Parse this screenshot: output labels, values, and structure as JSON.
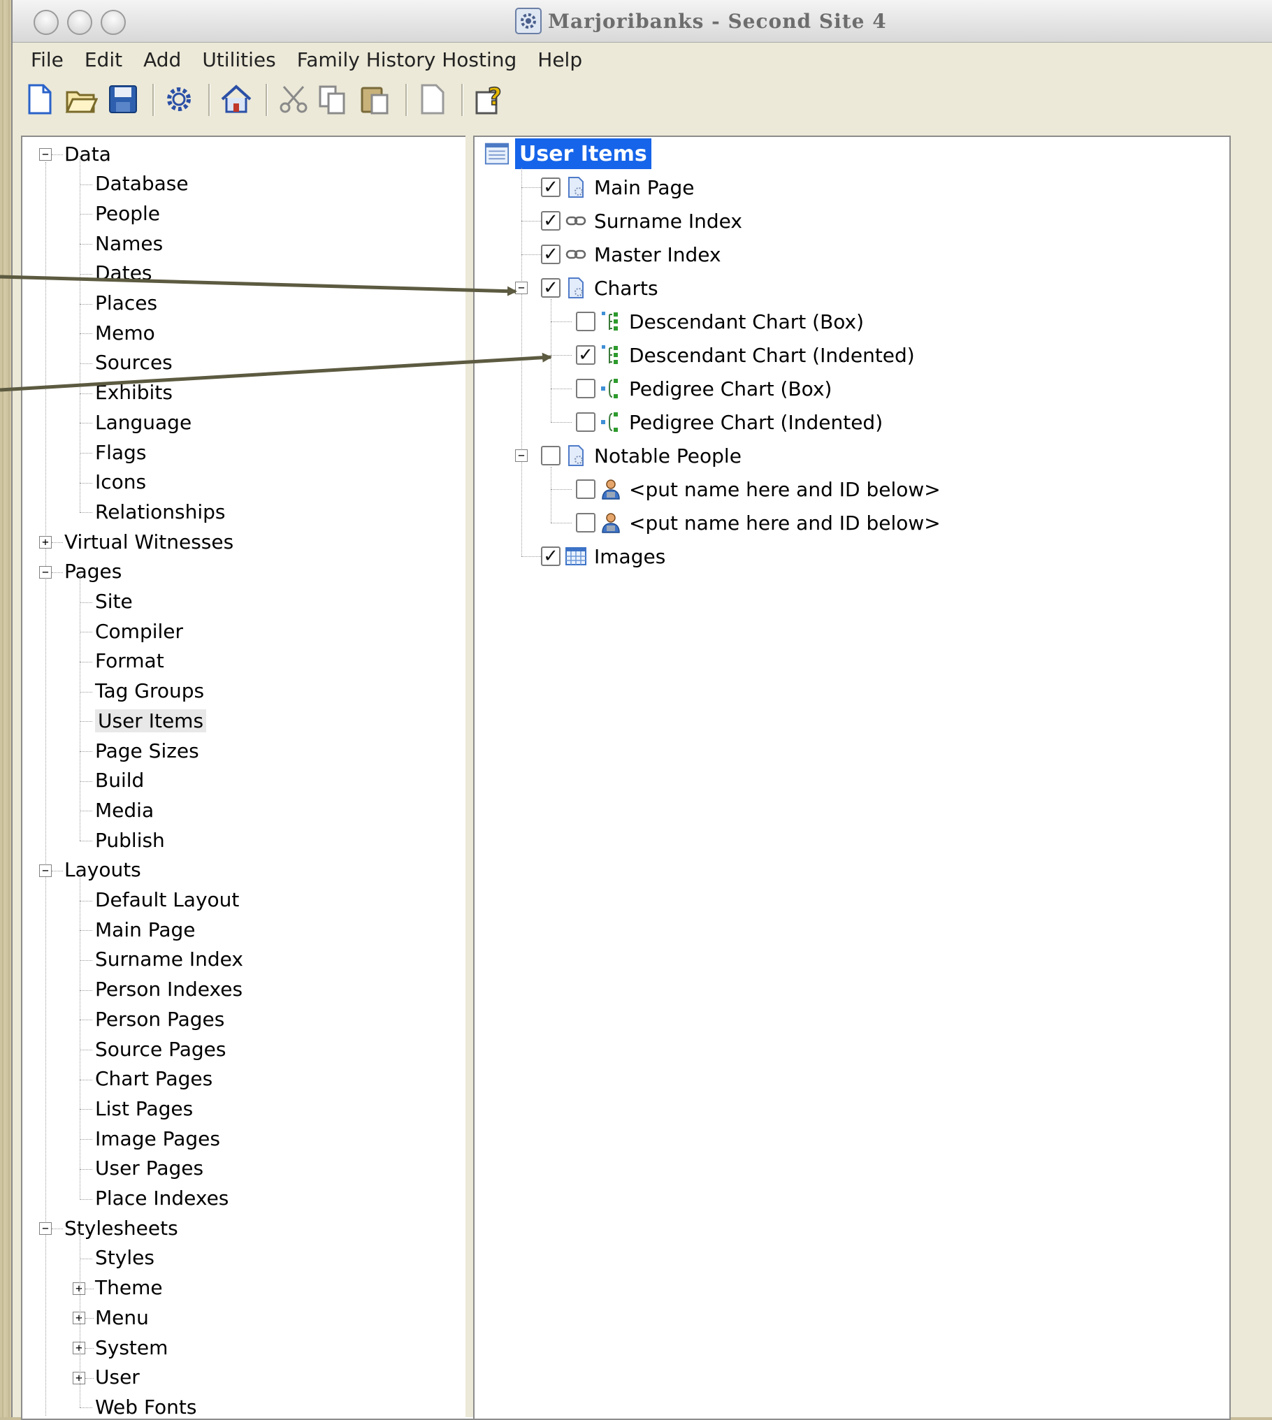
{
  "window": {
    "title": "Marjoribanks - Second Site 4"
  },
  "menubar": [
    "File",
    "Edit",
    "Add",
    "Utilities",
    "Family History Hosting",
    "Help"
  ],
  "toolbar": [
    "new-icon",
    "open-icon",
    "save-icon",
    "settings-icon",
    "home-icon",
    "cut-icon",
    "copy-icon",
    "paste-icon",
    "blank-page-icon",
    "help-icon"
  ],
  "left_tree": {
    "data": {
      "label": "Data",
      "children": [
        "Database",
        "People",
        "Names",
        "Dates",
        "Places",
        "Memo",
        "Sources",
        "Exhibits",
        "Language",
        "Flags",
        "Icons",
        "Relationships"
      ]
    },
    "virtual_witnesses": {
      "label": "Virtual Witnesses"
    },
    "pages": {
      "label": "Pages",
      "children": [
        "Site",
        "Compiler",
        "Format",
        "Tag Groups",
        "User Items",
        "Page Sizes",
        "Build",
        "Media",
        "Publish"
      ]
    },
    "layouts": {
      "label": "Layouts",
      "children": [
        "Default Layout",
        "Main Page",
        "Surname Index",
        "Person Indexes",
        "Person Pages",
        "Source Pages",
        "Chart Pages",
        "List Pages",
        "Image Pages",
        "User Pages",
        "Place Indexes"
      ]
    },
    "stylesheets": {
      "label": "Stylesheets",
      "children": [
        "Styles",
        "Theme",
        "Menu",
        "System",
        "User",
        "Web Fonts"
      ]
    },
    "selected": "User Items"
  },
  "right_tree": {
    "root": "User Items",
    "items": [
      {
        "label": "Main Page",
        "checked": true,
        "icon": "page-icon"
      },
      {
        "label": "Surname Index",
        "checked": true,
        "icon": "link-icon"
      },
      {
        "label": "Master Index",
        "checked": true,
        "icon": "link-icon"
      },
      {
        "label": "Charts",
        "checked": true,
        "icon": "page-icon",
        "children": [
          {
            "label": "Descendant Chart (Box)",
            "checked": false,
            "icon": "descendant-chart-icon"
          },
          {
            "label": "Descendant Chart (Indented)",
            "checked": true,
            "icon": "descendant-chart-icon"
          },
          {
            "label": "Pedigree Chart (Box)",
            "checked": false,
            "icon": "pedigree-chart-icon"
          },
          {
            "label": "Pedigree Chart (Indented)",
            "checked": false,
            "icon": "pedigree-chart-icon"
          }
        ]
      },
      {
        "label": "Notable People",
        "checked": false,
        "icon": "page-icon",
        "children": [
          {
            "label": "<put name here and ID below>",
            "checked": false,
            "icon": "person-icon"
          },
          {
            "label": "<put name here and ID below>",
            "checked": false,
            "icon": "person-icon"
          }
        ]
      },
      {
        "label": "Images",
        "checked": true,
        "icon": "image-grid-icon"
      }
    ]
  },
  "check_mark": "✓"
}
